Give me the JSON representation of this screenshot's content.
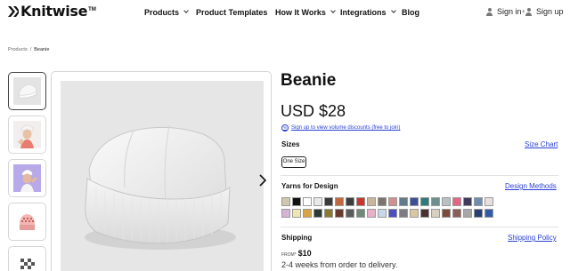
{
  "brand": {
    "name": "Knitwise",
    "tm": "TM"
  },
  "nav": {
    "products": "Products",
    "product_templates": "Product Templates",
    "how_it_works": "How It Works",
    "integrations": "Integrations",
    "blog": "Blog"
  },
  "auth": {
    "sign_in": "Sign in",
    "sign_up": "Sign up"
  },
  "breadcrumb": {
    "root": "Products",
    "separator": "/",
    "current": "Beanie"
  },
  "thumbnails": [
    "hat-flat-icon",
    "person-wearing-hat-icon",
    "person-wearing-hat-icon",
    "pink-hat-icon",
    "checkered-hat-icon"
  ],
  "product": {
    "title": "Beanie",
    "price": "USD $28",
    "volume_link": "Sign up to view volume discounts (free to join)",
    "sizes_label": "Sizes",
    "size_chart_link": "Size Chart",
    "size_option": "One Size",
    "yarns_label": "Yarns for Design",
    "design_methods_link": "Design Methods",
    "shipping_label": "Shipping",
    "shipping_policy_link": "Shipping Policy",
    "shipping_from_label": "FROM*",
    "shipping_from_price": "$10",
    "delivery_text": "2-4 weeks from order to delivery."
  },
  "yarn_colors": [
    "#cfc7ae",
    "#111111",
    "#ffffff",
    "#e8e8e8",
    "#3a3a3a",
    "#c1683f",
    "#3d3d3d",
    "#c8372d",
    "#c8b79d",
    "#7d7470",
    "#d2908c",
    "#5f7b8c",
    "#3c4f99",
    "#2e7a7c",
    "#6e8f8d",
    "#b9c1c5",
    "#e26785",
    "#3d3a5b",
    "#6d8cb1",
    "#eadddd",
    "#d6b4d4",
    "#f0e6b0",
    "#d9a443",
    "#2b3a33",
    "#8a7a2e",
    "#6a3b2c",
    "#5b5b5b",
    "#6e8a76",
    "#e9b1c8",
    "#c7d8e8",
    "#4b4ec4",
    "#7f7b83",
    "#d9c7a0",
    "#4a3030",
    "#d8d1c0",
    "#7b4c3a",
    "#8a5d58",
    "#a7a7a7",
    "#263e73",
    "#2f5da8"
  ]
}
